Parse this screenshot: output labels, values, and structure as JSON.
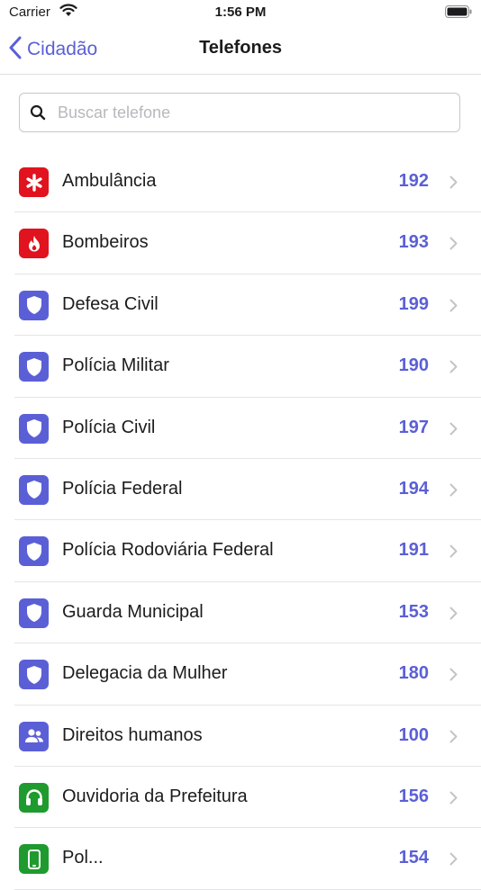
{
  "status_bar": {
    "carrier": "Carrier",
    "time": "1:56 PM"
  },
  "nav": {
    "back_label": "Cidadão",
    "title": "Telefones"
  },
  "search": {
    "placeholder": "Buscar telefone",
    "value": ""
  },
  "colors": {
    "accent": "#5b5fd6",
    "red": "#e0131e",
    "green": "#1f9a2e"
  },
  "items": [
    {
      "label": "Ambulância",
      "number": "192",
      "icon": "asterisk-icon",
      "color": "#e0131e"
    },
    {
      "label": "Bombeiros",
      "number": "193",
      "icon": "fire-icon",
      "color": "#e0131e"
    },
    {
      "label": "Defesa Civil",
      "number": "199",
      "icon": "shield-icon",
      "color": "#5b5fd6"
    },
    {
      "label": "Polícia Militar",
      "number": "190",
      "icon": "shield-icon",
      "color": "#5b5fd6"
    },
    {
      "label": "Polícia Civil",
      "number": "197",
      "icon": "shield-icon",
      "color": "#5b5fd6"
    },
    {
      "label": "Polícia Federal",
      "number": "194",
      "icon": "shield-icon",
      "color": "#5b5fd6"
    },
    {
      "label": "Polícia Rodoviária Federal",
      "number": "191",
      "icon": "shield-icon",
      "color": "#5b5fd6"
    },
    {
      "label": "Guarda Municipal",
      "number": "153",
      "icon": "shield-icon",
      "color": "#5b5fd6"
    },
    {
      "label": "Delegacia da Mulher",
      "number": "180",
      "icon": "shield-icon",
      "color": "#5b5fd6"
    },
    {
      "label": "Direitos humanos",
      "number": "100",
      "icon": "people-icon",
      "color": "#5b5fd6"
    },
    {
      "label": "Ouvidoria da Prefeitura",
      "number": "156",
      "icon": "headphones-icon",
      "color": "#1f9a2e"
    },
    {
      "label": "Pol...",
      "number": "154",
      "icon": "phone-icon",
      "color": "#1f9a2e"
    }
  ]
}
